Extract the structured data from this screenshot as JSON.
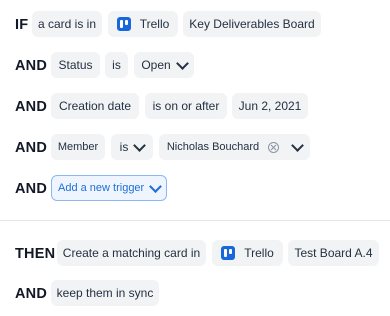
{
  "if_block": {
    "keyword": "IF",
    "subject": "a card is in",
    "app": "Trello",
    "board": "Key Deliverables Board"
  },
  "conditions": [
    {
      "keyword": "AND",
      "field": "Status",
      "operator": "is",
      "value": "Open"
    },
    {
      "keyword": "AND",
      "field": "Creation date",
      "operator": "is on or after",
      "value": "Jun 2, 2021"
    },
    {
      "keyword": "AND",
      "field": "Member",
      "operator": "is",
      "value": "Nicholas Bouchard"
    }
  ],
  "add_trigger": {
    "keyword": "AND",
    "label": "Add a new trigger"
  },
  "then_block": {
    "keyword": "THEN",
    "action": "Create a matching card in",
    "app": "Trello",
    "board": "Test Board A.4"
  },
  "then_and": {
    "keyword": "AND",
    "label": "keep them in sync"
  },
  "colors": {
    "chip_bg": "#f1f3f5",
    "trigger_bg": "#eef5ff",
    "trigger_border": "#8bb8f0",
    "trigger_text": "#1f6fd6",
    "trello_blue": "#1868db"
  },
  "icons": {
    "trello": "trello-icon",
    "chevron": "chevron-down-icon",
    "clear": "clear-icon"
  }
}
